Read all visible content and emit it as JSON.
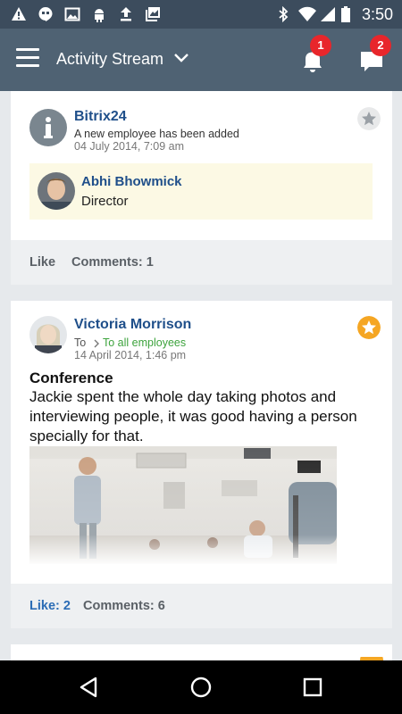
{
  "status_bar": {
    "time": "3:50",
    "icons": [
      "alert-icon",
      "hangouts-icon",
      "image-icon",
      "android-icon",
      "upload-icon",
      "photo-library-icon",
      "bluetooth-icon",
      "wifi-icon",
      "signal-icon",
      "battery-icon"
    ]
  },
  "app_bar": {
    "title": "Activity Stream",
    "notifications_count": "1",
    "messages_count": "2"
  },
  "posts": [
    {
      "author": "Bitrix24",
      "message": "A new employee has been added",
      "date": "04 July 2014, 7:09 am",
      "starred": false,
      "employee": {
        "name": "Abhi Bhowmick",
        "role": "Director"
      },
      "footer": {
        "like": "Like",
        "comments": "Comments: 1"
      }
    },
    {
      "author": "Victoria Morrison",
      "to_label": "To",
      "recipients": "To all employees",
      "date": "14 April 2014, 1:46 pm",
      "starred": true,
      "title": "Conference",
      "body": "Jackie spent the whole day taking photos and interviewing people, it was good having a person specially for that.",
      "footer": {
        "like": "Like: 2",
        "comments": "Comments: 6"
      }
    }
  ],
  "colors": {
    "status_bar": "#3c4c5d",
    "app_bar": "#4f6273",
    "link": "#1f4f8a",
    "accent_star": "#f5a623",
    "badge": "#e8262b"
  }
}
